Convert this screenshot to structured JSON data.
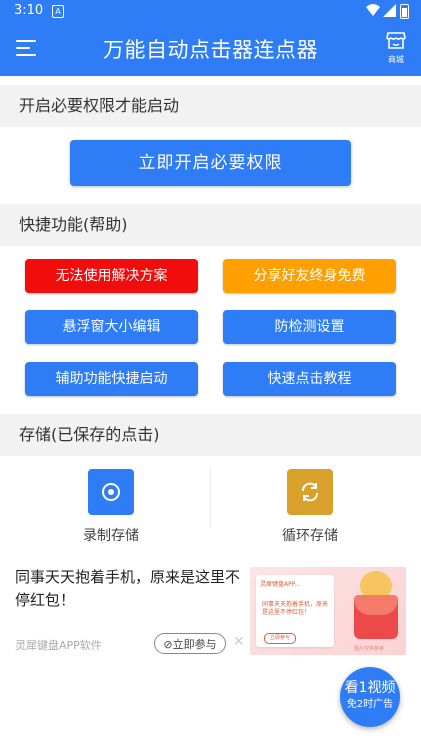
{
  "status_bar": {
    "time": "3:10",
    "sim_label": "A"
  },
  "app_bar": {
    "title": "万能自动点击器连点器",
    "shop_label": "商城",
    "menu_icon": "menu-icon",
    "shop_icon": "store-icon"
  },
  "permission_section": {
    "heading": "开启必要权限才能启动",
    "button_label": "立即开启必要权限"
  },
  "quick_section": {
    "heading": "快捷功能(帮助)",
    "buttons": [
      {
        "label": "无法使用解决方案",
        "color": "#f30c0c"
      },
      {
        "label": "分享好友终身免费",
        "color": "#ffa000"
      },
      {
        "label": "悬浮窗大小编辑",
        "color": "#2f7df6"
      },
      {
        "label": "防检测设置",
        "color": "#2f7df6"
      },
      {
        "label": "辅助功能快捷启动",
        "color": "#2f7df6"
      },
      {
        "label": "快速点击教程",
        "color": "#2f7df6"
      }
    ]
  },
  "storage_section": {
    "heading": "存储(已保存的点击)",
    "items": [
      {
        "label": "录制存储",
        "icon": "record-icon",
        "color": "#2f7df6"
      },
      {
        "label": "循环存储",
        "icon": "loop-icon",
        "color": "#d9a12b"
      }
    ]
  },
  "ad": {
    "text": "同事天天抱着手机，原来是这里不停红包！",
    "source": "灵犀键盘APP软件",
    "join_label": "立即参与",
    "close_symbol": "✕",
    "image": {
      "brand": "灵犀键盘APP...",
      "message": "同事天天抱着手机，原来是这里不停红包！",
      "button": "立即参与",
      "mascot_text": "赚现金",
      "disclaimer": "图片仅供参考"
    }
  },
  "video_fab": {
    "line1": "看1视频",
    "line2": "免2时广告"
  }
}
